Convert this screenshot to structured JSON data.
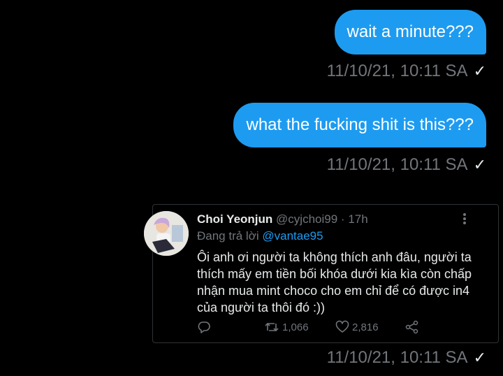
{
  "messages": [
    {
      "text": "wait a minute???",
      "timestamp": "11/10/21, 10:11 SA"
    },
    {
      "text": "what the fucking shit is this???",
      "timestamp": "11/10/21, 10:11 SA"
    }
  ],
  "shared_tweet": {
    "name": "Choi Yeonjun",
    "handle": "@cyjchoi99",
    "separator": "·",
    "time": "17h",
    "reply_prefix": "Đang trả lời",
    "reply_to": "@vantae95",
    "text": "Ôi anh ơi người ta không thích anh đâu, người ta thích mấy em tiền bối khóa dưới kia kìa còn chấp nhận mua mint choco cho em chỉ để có được in4 của người ta thôi đó :))",
    "retweets": "1,066",
    "likes": "2,816",
    "timestamp": "11/10/21, 10:11 SA"
  },
  "icons": {
    "sent": "checkmark-icon",
    "reply": "reply-icon",
    "retweet": "retweet-icon",
    "like": "heart-icon",
    "share": "share-icon",
    "more": "more-icon"
  },
  "colors": {
    "background": "#000000",
    "bubble": "#1d9bf0",
    "muted": "#71767b",
    "text": "#e7e9ea",
    "link": "#1d9bf0"
  }
}
